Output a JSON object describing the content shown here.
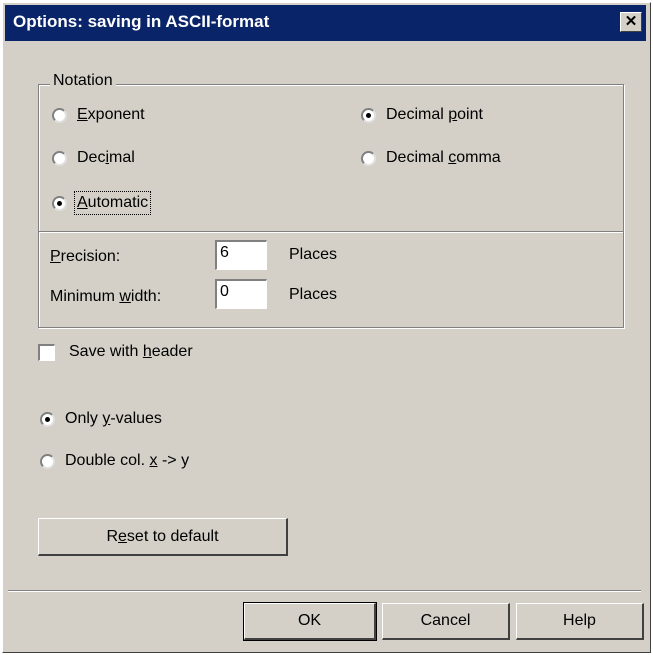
{
  "window": {
    "title": "Options: saving in ASCII-format",
    "close_glyph": "✕"
  },
  "notation": {
    "legend": "Notation",
    "exponent": {
      "pre": "",
      "key": "E",
      "post": "xponent",
      "selected": false
    },
    "decimal": {
      "pre": "Dec",
      "key": "i",
      "post": "mal",
      "selected": false
    },
    "automatic": {
      "pre": "",
      "key": "A",
      "post": "utomatic",
      "selected": true
    },
    "decimal_point": {
      "pre": "Decimal ",
      "key": "p",
      "post": "oint",
      "selected": true
    },
    "decimal_comma": {
      "pre": "Decimal ",
      "key": "c",
      "post": "omma",
      "selected": false
    }
  },
  "precision": {
    "pre": "",
    "key": "P",
    "post": "recision:",
    "value": "6",
    "unit": "Places"
  },
  "min_width": {
    "pre": "Minimum ",
    "key": "w",
    "post": "idth:",
    "value": "0",
    "unit": "Places"
  },
  "save_header": {
    "pre": "Save with ",
    "key": "h",
    "post": "eader",
    "checked": false
  },
  "output": {
    "only_y": {
      "pre": "Only ",
      "key": "y",
      "post": "-values",
      "selected": true
    },
    "double_col": {
      "pre": "Double col. ",
      "key": "x",
      "post": " -> y",
      "selected": false
    }
  },
  "buttons": {
    "reset": {
      "pre": "R",
      "key": "e",
      "post": "set to default"
    },
    "ok": "OK",
    "cancel": "Cancel",
    "help": "Help"
  }
}
